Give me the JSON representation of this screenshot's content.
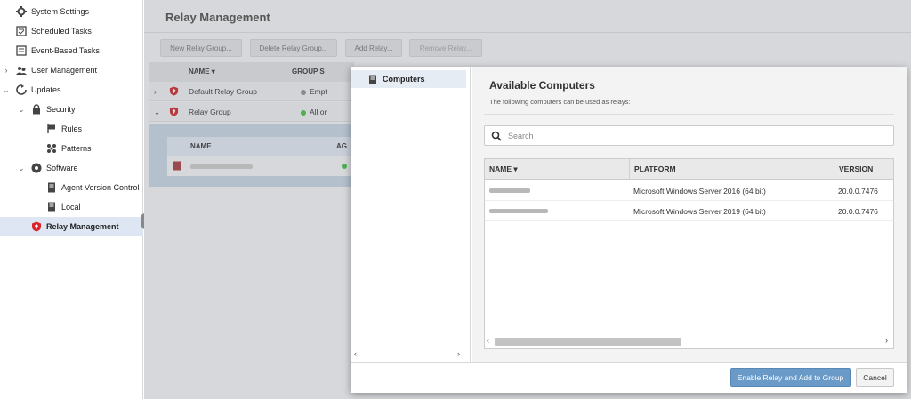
{
  "sidebar": {
    "items": [
      {
        "label": "System Settings",
        "icon": "gear-icon"
      },
      {
        "label": "Scheduled Tasks",
        "icon": "scheduled-tasks-icon"
      },
      {
        "label": "Event-Based Tasks",
        "icon": "event-tasks-icon"
      },
      {
        "label": "User Management",
        "icon": "users-icon"
      },
      {
        "label": "Updates",
        "icon": "updates-icon"
      },
      {
        "label": "Security",
        "icon": "lock-icon"
      },
      {
        "label": "Rules",
        "icon": "flag-icon"
      },
      {
        "label": "Patterns",
        "icon": "patterns-icon"
      },
      {
        "label": "Software",
        "icon": "software-icon"
      },
      {
        "label": "Agent Version Control",
        "icon": "server-icon"
      },
      {
        "label": "Local",
        "icon": "server-icon"
      },
      {
        "label": "Relay Management",
        "icon": "relay-shield-icon"
      }
    ]
  },
  "main": {
    "title": "Relay Management",
    "toolbar": {
      "new_group": "New Relay Group...",
      "delete_group": "Delete Relay Group...",
      "add_relay": "Add Relay...",
      "remove_relay": "Remove Relay..."
    },
    "grid": {
      "col_name": "NAME",
      "col_group_status": "GROUP S",
      "rows": [
        {
          "name": "Default Relay Group",
          "status": "Empt",
          "status_color": "#8a8a8a"
        },
        {
          "name": "Relay Group",
          "status": "All or",
          "status_color": "#4caf50"
        }
      ],
      "sub_col_name": "NAME",
      "sub_col_agent": "AG"
    }
  },
  "modal": {
    "nav_item": "Computers",
    "title": "Available Computers",
    "subtitle": "The following computers can be used as relays:",
    "search_placeholder": "Search",
    "table": {
      "col_name": "NAME",
      "col_platform": "PLATFORM",
      "col_version": "VERSION",
      "rows": [
        {
          "platform": "Microsoft Windows Server 2016 (64 bit)",
          "version": "20.0.0.7476"
        },
        {
          "platform": "Microsoft Windows Server 2019 (64 bit)",
          "version": "20.0.0.7476"
        }
      ]
    },
    "buttons": {
      "primary": "Enable Relay and Add to Group",
      "cancel": "Cancel"
    },
    "colors": {
      "primary": "#6a9ac8",
      "selected_nav": "#e6ecf4"
    }
  }
}
